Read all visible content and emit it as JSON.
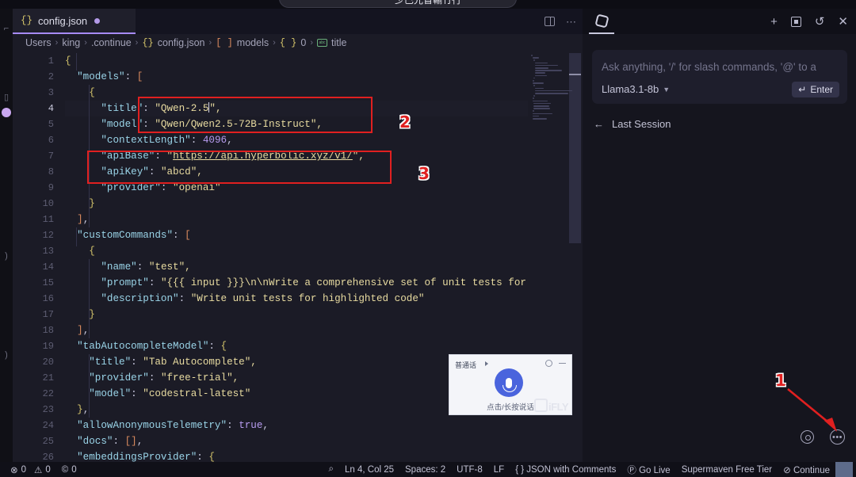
{
  "window": {
    "float_pill_text": "少巴光盲輸竹行"
  },
  "editor": {
    "tab": {
      "brace": "{}",
      "filename": "config.json",
      "dirty": true
    },
    "tab_actions": [
      {
        "name": "split-editor-icon",
        "glyph": ""
      },
      {
        "name": "more-actions-icon",
        "glyph": "⋯"
      }
    ],
    "breadcrumb": [
      "Users",
      "king",
      ".continue",
      "config.json",
      "models",
      "0",
      "title"
    ],
    "breadcrumb_icons": {
      "config": "{}",
      "models": "[ ]",
      "zero": "{ }",
      "title": "abc"
    },
    "active_line": 4,
    "lines": [
      {
        "n": 1,
        "tokens": [
          {
            "t": "{",
            "c": "cbr"
          }
        ]
      },
      {
        "n": 2,
        "tokens": [
          {
            "t": "  \"models\"",
            "c": "k"
          },
          {
            "t": ": ",
            "c": "p"
          },
          {
            "t": "[",
            "c": "br"
          }
        ]
      },
      {
        "n": 3,
        "tokens": [
          {
            "t": "    {",
            "c": "cbr"
          }
        ]
      },
      {
        "n": 4,
        "tokens": [
          {
            "t": "      \"title\"",
            "c": "k"
          },
          {
            "t": ": ",
            "c": "p"
          },
          {
            "t": "\"Qwen-2.5",
            "c": "s"
          },
          {
            "t": "|",
            "c": "caret"
          },
          {
            "t": "\",",
            "c": "s"
          }
        ]
      },
      {
        "n": 5,
        "tokens": [
          {
            "t": "      \"model\"",
            "c": "k"
          },
          {
            "t": ": ",
            "c": "p"
          },
          {
            "t": "\"Qwen/Qwen2.5-72B-Instruct\",",
            "c": "s"
          }
        ]
      },
      {
        "n": 6,
        "tokens": [
          {
            "t": "      \"contextLength\"",
            "c": "k"
          },
          {
            "t": ": ",
            "c": "p"
          },
          {
            "t": "4096",
            "c": "n"
          },
          {
            "t": ",",
            "c": "p"
          }
        ]
      },
      {
        "n": 7,
        "tokens": [
          {
            "t": "      \"apiBase\"",
            "c": "k"
          },
          {
            "t": ": ",
            "c": "p"
          },
          {
            "t": "\"",
            "c": "s"
          },
          {
            "t": "https://api.hyperbolic.xyz/v1/",
            "c": "lnk"
          },
          {
            "t": "\",",
            "c": "s"
          }
        ]
      },
      {
        "n": 8,
        "tokens": [
          {
            "t": "      \"apiKey\"",
            "c": "k"
          },
          {
            "t": ": ",
            "c": "p"
          },
          {
            "t": "\"abcd\",",
            "c": "s"
          }
        ]
      },
      {
        "n": 9,
        "tokens": [
          {
            "t": "      \"provider\"",
            "c": "k"
          },
          {
            "t": ": ",
            "c": "p"
          },
          {
            "t": "\"openai\"",
            "c": "s"
          }
        ]
      },
      {
        "n": 10,
        "tokens": [
          {
            "t": "    }",
            "c": "cbr"
          }
        ]
      },
      {
        "n": 11,
        "tokens": [
          {
            "t": "  ]",
            "c": "br"
          },
          {
            "t": ",",
            "c": "p"
          }
        ]
      },
      {
        "n": 12,
        "tokens": [
          {
            "t": "  \"customCommands\"",
            "c": "k"
          },
          {
            "t": ": ",
            "c": "p"
          },
          {
            "t": "[",
            "c": "br"
          }
        ]
      },
      {
        "n": 13,
        "tokens": [
          {
            "t": "    {",
            "c": "cbr"
          }
        ]
      },
      {
        "n": 14,
        "tokens": [
          {
            "t": "      \"name\"",
            "c": "k"
          },
          {
            "t": ": ",
            "c": "p"
          },
          {
            "t": "\"test\",",
            "c": "s"
          }
        ]
      },
      {
        "n": 15,
        "tokens": [
          {
            "t": "      \"prompt\"",
            "c": "k"
          },
          {
            "t": ": ",
            "c": "p"
          },
          {
            "t": "\"{{{ input }}}\\n\\nWrite a comprehensive set of unit tests for th",
            "c": "s"
          }
        ]
      },
      {
        "n": 16,
        "tokens": [
          {
            "t": "      \"description\"",
            "c": "k"
          },
          {
            "t": ": ",
            "c": "p"
          },
          {
            "t": "\"Write unit tests for highlighted code\"",
            "c": "s"
          }
        ]
      },
      {
        "n": 17,
        "tokens": [
          {
            "t": "    }",
            "c": "cbr"
          }
        ]
      },
      {
        "n": 18,
        "tokens": [
          {
            "t": "  ]",
            "c": "br"
          },
          {
            "t": ",",
            "c": "p"
          }
        ]
      },
      {
        "n": 19,
        "tokens": [
          {
            "t": "  \"tabAutocompleteModel\"",
            "c": "k"
          },
          {
            "t": ": ",
            "c": "p"
          },
          {
            "t": "{",
            "c": "cbr"
          }
        ]
      },
      {
        "n": 20,
        "tokens": [
          {
            "t": "    \"title\"",
            "c": "k"
          },
          {
            "t": ": ",
            "c": "p"
          },
          {
            "t": "\"Tab Autocomplete\",",
            "c": "s"
          }
        ]
      },
      {
        "n": 21,
        "tokens": [
          {
            "t": "    \"provider\"",
            "c": "k"
          },
          {
            "t": ": ",
            "c": "p"
          },
          {
            "t": "\"free-trial\",",
            "c": "s"
          }
        ]
      },
      {
        "n": 22,
        "tokens": [
          {
            "t": "    \"model\"",
            "c": "k"
          },
          {
            "t": ": ",
            "c": "p"
          },
          {
            "t": "\"codestral-latest\"",
            "c": "s"
          }
        ]
      },
      {
        "n": 23,
        "tokens": [
          {
            "t": "  }",
            "c": "cbr"
          },
          {
            "t": ",",
            "c": "p"
          }
        ]
      },
      {
        "n": 24,
        "tokens": [
          {
            "t": "  \"allowAnonymousTelemetry\"",
            "c": "k"
          },
          {
            "t": ": ",
            "c": "p"
          },
          {
            "t": "true",
            "c": "b"
          },
          {
            "t": ",",
            "c": "p"
          }
        ]
      },
      {
        "n": 25,
        "tokens": [
          {
            "t": "  \"docs\"",
            "c": "k"
          },
          {
            "t": ": ",
            "c": "p"
          },
          {
            "t": "[]",
            "c": "br"
          },
          {
            "t": ",",
            "c": "p"
          }
        ]
      },
      {
        "n": 26,
        "tokens": [
          {
            "t": "  \"embeddingsProvider\"",
            "c": "k"
          },
          {
            "t": ": ",
            "c": "p"
          },
          {
            "t": "{",
            "c": "cbr"
          }
        ]
      }
    ]
  },
  "continue_panel": {
    "logo_name": "continue-logo",
    "actions": [
      {
        "name": "new-session-button",
        "glyph": "+"
      },
      {
        "name": "expand-panel-button",
        "glyph": ""
      },
      {
        "name": "history-button",
        "glyph": "↺"
      },
      {
        "name": "close-panel-button",
        "glyph": "✕"
      }
    ],
    "composer": {
      "placeholder": "Ask anything, '/' for slash commands, '@' to a",
      "model": "Llama3.1-8b",
      "enter_label": "Enter",
      "enter_glyph": "↵"
    },
    "last_session_label": "Last Session",
    "last_session_arrow": "←",
    "footer_icons": [
      {
        "name": "settings-gear-icon"
      },
      {
        "name": "more-options-icon"
      }
    ]
  },
  "statusbar": {
    "left": [
      {
        "name": "errors-indicator",
        "icon": "⊗",
        "value": "0"
      },
      {
        "name": "warnings-indicator",
        "icon": "⚠",
        "value": "0"
      },
      {
        "name": "ports-indicator",
        "icon": "©",
        "value": "0"
      }
    ],
    "right": [
      {
        "name": "search-status-icon",
        "label": "⌕"
      },
      {
        "name": "cursor-position",
        "label": "Ln 4, Col 25"
      },
      {
        "name": "indentation",
        "label": "Spaces: 2"
      },
      {
        "name": "encoding",
        "label": "UTF-8"
      },
      {
        "name": "line-endings",
        "label": "LF"
      },
      {
        "name": "language-mode",
        "label": "{ } JSON with Comments"
      },
      {
        "name": "go-live",
        "label": "Ⓟ Go Live"
      },
      {
        "name": "supermaven-status",
        "label": "Supermaven Free Tier"
      },
      {
        "name": "continue-status",
        "label": "⊘ Continue"
      }
    ]
  },
  "voice_widget": {
    "language": "普通话",
    "hint": "点击/长按说话",
    "watermark": "iFLY"
  },
  "annotations": [
    {
      "name": "annotation-1",
      "number": "1",
      "target": "settings-gear-icon"
    },
    {
      "name": "annotation-2",
      "number": "2",
      "target": "title-and-model-fields"
    },
    {
      "name": "annotation-3",
      "number": "3",
      "target": "apibase-and-apikey-fields"
    }
  ],
  "colors": {
    "accent": "#a78bfa",
    "annotation": "#e02020",
    "editor_bg": "#1b1b26",
    "panel_bg": "#15151e",
    "statusbar_bg": "#101018",
    "string": "#e8dba0",
    "key": "#9ad4e8",
    "number": "#b79cf0"
  }
}
